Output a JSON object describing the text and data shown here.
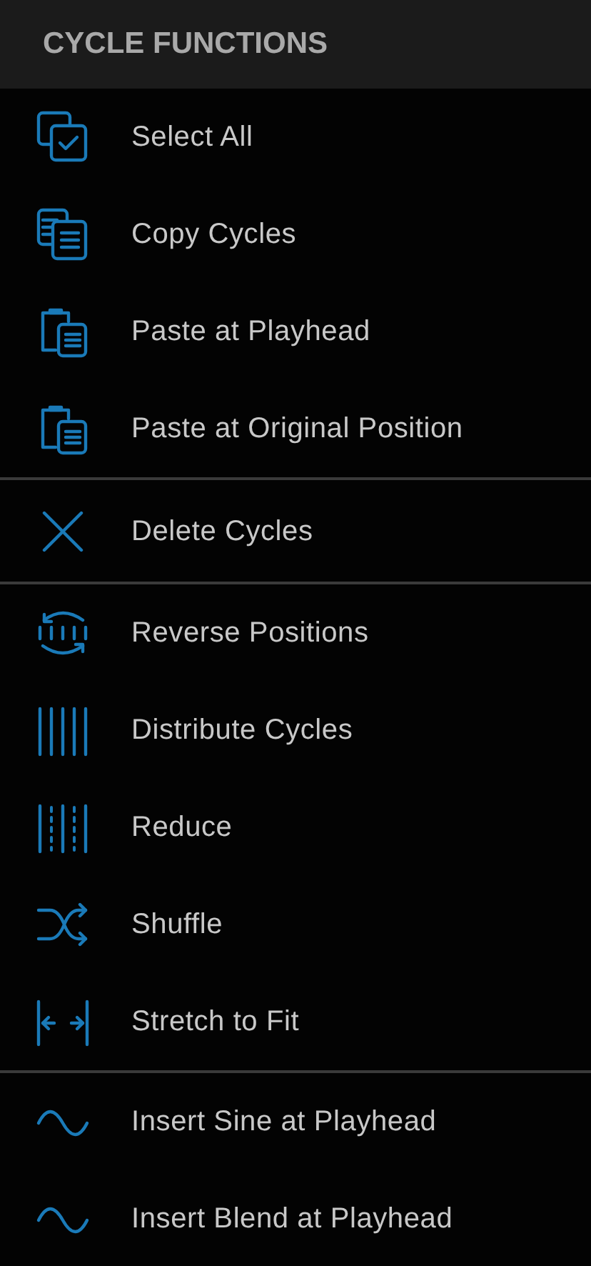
{
  "header": {
    "title": "CYCLE FUNCTIONS"
  },
  "groups": [
    {
      "items": [
        {
          "label": "Select All",
          "kind": "select"
        },
        {
          "label": "Copy Cycles",
          "kind": "copy"
        },
        {
          "label": "Paste at Playhead",
          "kind": "paste"
        },
        {
          "label": "Paste at Original Position",
          "kind": "paste"
        }
      ]
    },
    {
      "items": [
        {
          "label": "Delete Cycles",
          "kind": "delete"
        }
      ]
    },
    {
      "items": [
        {
          "label": "Reverse Positions",
          "kind": "reverse"
        },
        {
          "label": "Distribute Cycles",
          "kind": "distribute"
        },
        {
          "label": "Reduce",
          "kind": "reduce"
        },
        {
          "label": "Shuffle",
          "kind": "shuffle"
        },
        {
          "label": "Stretch to Fit",
          "kind": "stretch"
        }
      ]
    },
    {
      "items": [
        {
          "label": "Insert Sine at Playhead",
          "kind": "sine"
        },
        {
          "label": "Insert Blend at Playhead",
          "kind": "sine"
        }
      ]
    }
  ]
}
